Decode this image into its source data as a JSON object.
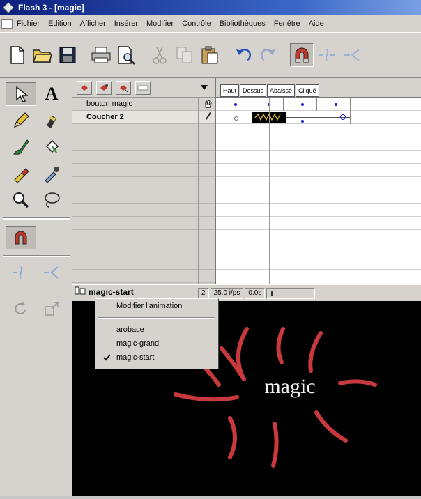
{
  "window": {
    "title": "Flash 3 - [magic]"
  },
  "menu": [
    "Fichier",
    "Edition",
    "Afficher",
    "Insérer",
    "Modifier",
    "Contrôle",
    "Bibliothèques",
    "Fenêtre",
    "Aide"
  ],
  "toolbar": {
    "icons": [
      "new-file-icon",
      "open-folder-icon",
      "save-disk-icon",
      "print-icon",
      "print-preview-icon",
      "cut-icon",
      "copy-icon",
      "paste-icon",
      "undo-icon",
      "redo-icon",
      "magnet-snap-icon",
      "smooth-icon",
      "straighten-icon"
    ]
  },
  "tools": {
    "items": [
      "arrow-tool-icon",
      "text-tool-icon",
      "pencil-tool-icon",
      "ink-bottle-tool-icon",
      "brush-tool-icon",
      "paint-bucket-tool-icon",
      "dropper-eraser-icon",
      "eyedropper-tool-icon",
      "magnifier-tool-icon",
      "lasso-tool-icon"
    ],
    "text_tool_label": "A",
    "modifier_icons": [
      "magnet-modifier-icon",
      "smooth-modifier-icon",
      "straighten-modifier-icon",
      "rotate-modifier-icon",
      "scale-modifier-icon"
    ]
  },
  "layers": {
    "rows": [
      {
        "name": "bouton magic",
        "status": "hand-icon"
      },
      {
        "name": "Coucher 2",
        "status": "pencil-icon"
      }
    ]
  },
  "timeline": {
    "frame_labels": [
      "Haut",
      "Dessus",
      "Abaissé",
      "Cliqué"
    ]
  },
  "status": {
    "scene_name": "magic-start",
    "frame": "2",
    "fps": "25.0 i/ps",
    "time": "0.0s"
  },
  "popup": {
    "modify_label": "Modifier l'animation",
    "items": [
      "arobace",
      "magic-grand",
      "magic-start"
    ],
    "checked_item": "magic-start"
  },
  "stage": {
    "text": "magic",
    "text_color": "#f2f2f2",
    "ray_color": "#c8393e",
    "background": "#000000"
  }
}
